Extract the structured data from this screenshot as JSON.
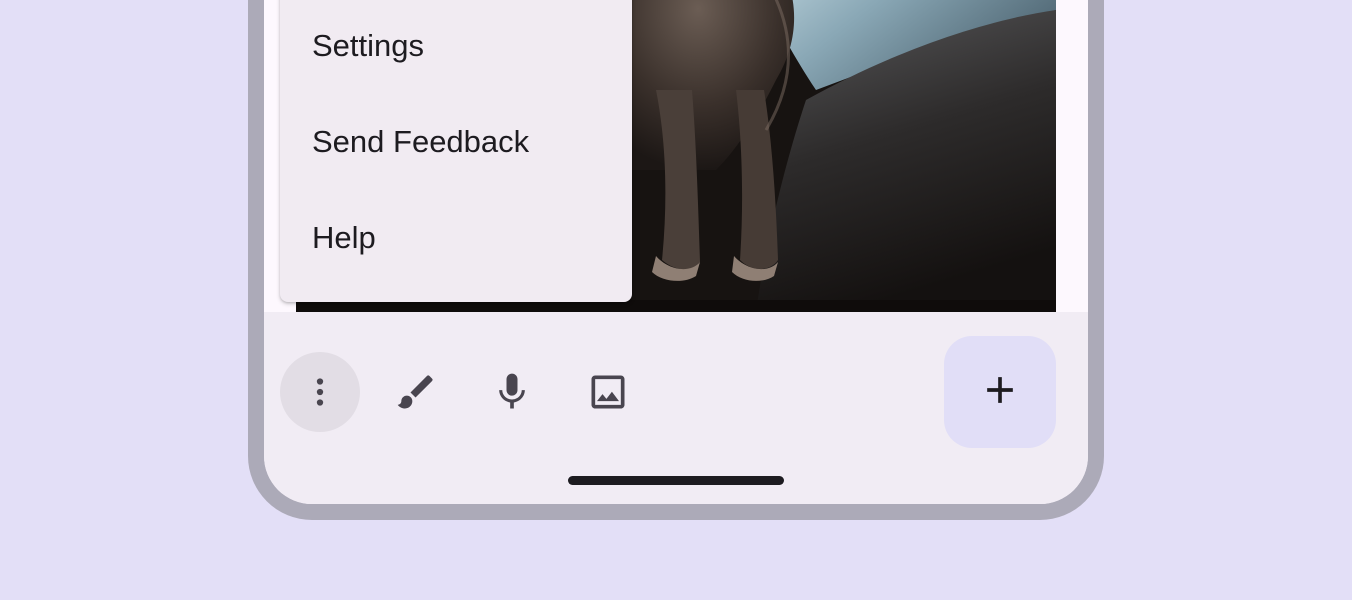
{
  "menu": {
    "items": [
      {
        "label": "Settings"
      },
      {
        "label": "Send Feedback"
      },
      {
        "label": "Help"
      }
    ]
  },
  "toolbar": {
    "buttons": [
      {
        "icon": "more-vert-icon",
        "active": true
      },
      {
        "icon": "brush-icon"
      },
      {
        "icon": "microphone-icon"
      },
      {
        "icon": "image-icon"
      }
    ],
    "fab_icon": "add-icon"
  },
  "colors": {
    "page_background": "#e3dff7",
    "frame": "#acaab8",
    "surface": "#f1ecf4",
    "menu_surface": "#f1ebf2",
    "fab_container": "#e1def7",
    "on_surface": "#1d1b20"
  }
}
